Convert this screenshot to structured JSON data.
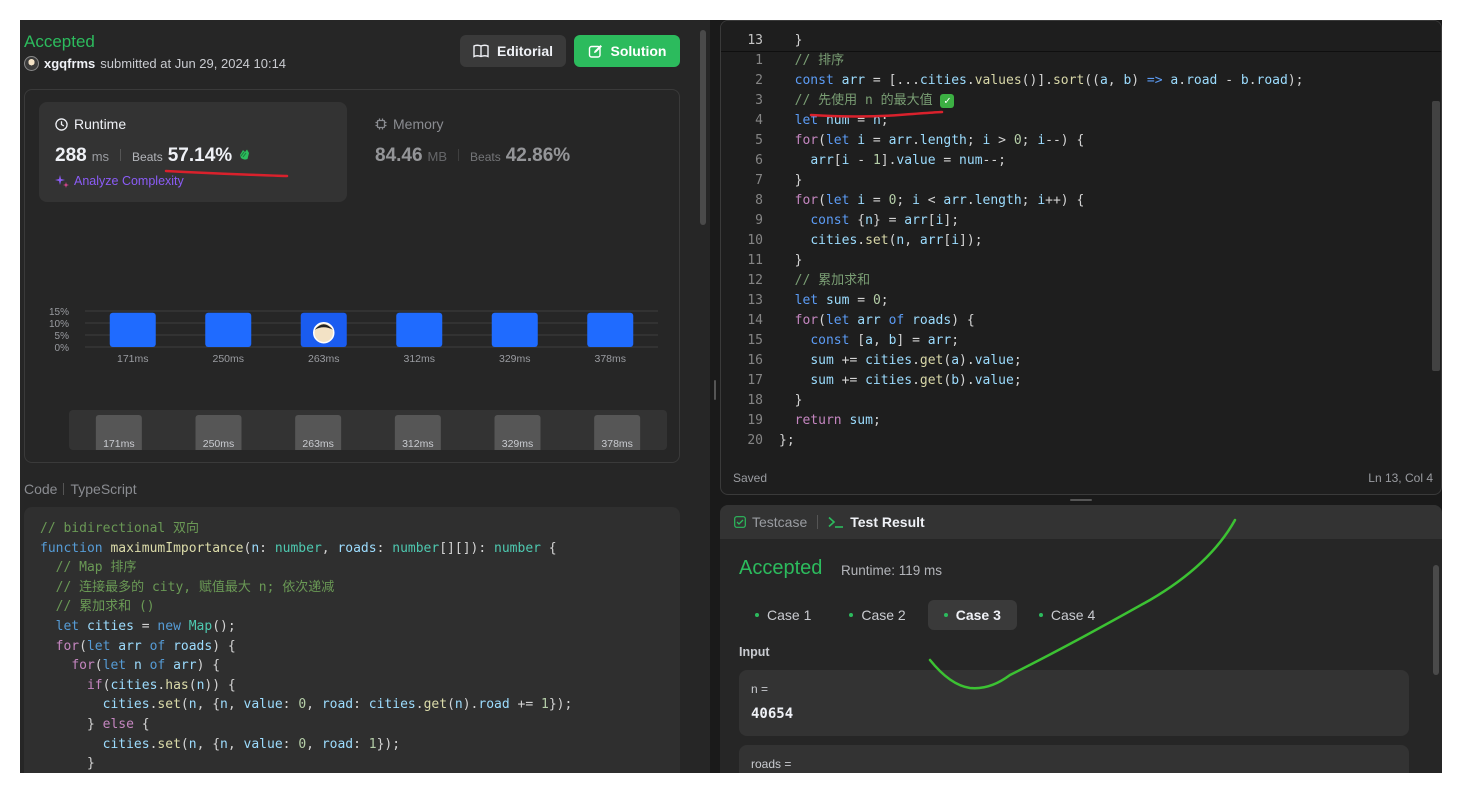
{
  "submission": {
    "status": "Accepted",
    "username": "xgqfrms",
    "submitted_text": "submitted at Jun 29, 2024 10:14"
  },
  "buttons": {
    "editorial": "Editorial",
    "solution": "Solution"
  },
  "runtime": {
    "title": "Runtime",
    "value": "288",
    "unit": "ms",
    "beats_label": "Beats",
    "beats_value": "57.14%",
    "analyze_label": "Analyze Complexity"
  },
  "memory": {
    "title": "Memory",
    "value": "84.46",
    "unit": "MB",
    "beats_label": "Beats",
    "beats_value": "42.86%"
  },
  "chart_data": {
    "type": "bar",
    "categories": [
      "171ms",
      "250ms",
      "263ms",
      "312ms",
      "329ms",
      "378ms"
    ],
    "values": [
      14.29,
      14.29,
      14.29,
      14.29,
      14.29,
      14.29
    ],
    "highlight_index": 2,
    "y_ticks": [
      "15%",
      "10%",
      "5%",
      "0%"
    ],
    "ylim": [
      0,
      15
    ],
    "grid": true,
    "title": "",
    "xlabel": "",
    "ylabel": "",
    "bar_color": "#1f6bff",
    "highlight_color": "#1a5cf0"
  },
  "mini_nav": {
    "labels": [
      "171ms",
      "250ms",
      "263ms",
      "312ms",
      "329ms",
      "378ms"
    ]
  },
  "code_section": {
    "label": "Code",
    "language": "TypeScript"
  },
  "submitted_code": [
    [
      [
        "cm",
        "// bidirectional 双向"
      ]
    ],
    [
      [
        "kw",
        "function "
      ],
      [
        "fn",
        "maximumImportance"
      ],
      [
        "pl",
        "("
      ],
      [
        "id",
        "n"
      ],
      [
        "pl",
        ": "
      ],
      [
        "ty",
        "number"
      ],
      [
        "pl",
        ", "
      ],
      [
        "id",
        "roads"
      ],
      [
        "pl",
        ": "
      ],
      [
        "ty",
        "number"
      ],
      [
        "pl",
        "[][]): "
      ],
      [
        "ty",
        "number"
      ],
      [
        "pl",
        " {"
      ]
    ],
    [
      [
        "pl",
        "  "
      ],
      [
        "cm",
        "// Map 排序"
      ]
    ],
    [
      [
        "pl",
        "  "
      ],
      [
        "cm",
        "// 连接最多的 city, 赋值最大 n; 依次递减"
      ]
    ],
    [
      [
        "pl",
        "  "
      ],
      [
        "cm",
        "// 累加求和 ()"
      ]
    ],
    [
      [
        "pl",
        "  "
      ],
      [
        "kw",
        "let "
      ],
      [
        "id",
        "cities"
      ],
      [
        "pl",
        " = "
      ],
      [
        "kw",
        "new "
      ],
      [
        "ty",
        "Map"
      ],
      [
        "pl",
        "();"
      ]
    ],
    [
      [
        "pl",
        "  "
      ],
      [
        "kw2",
        "for"
      ],
      [
        "pl",
        "("
      ],
      [
        "kw",
        "let "
      ],
      [
        "id",
        "arr "
      ],
      [
        "kw",
        "of "
      ],
      [
        "id",
        "roads"
      ],
      [
        "pl",
        ") {"
      ]
    ],
    [
      [
        "pl",
        "    "
      ],
      [
        "kw2",
        "for"
      ],
      [
        "pl",
        "("
      ],
      [
        "kw",
        "let "
      ],
      [
        "id",
        "n "
      ],
      [
        "kw",
        "of "
      ],
      [
        "id",
        "arr"
      ],
      [
        "pl",
        ") {"
      ]
    ],
    [
      [
        "pl",
        "      "
      ],
      [
        "kw2",
        "if"
      ],
      [
        "pl",
        "("
      ],
      [
        "id",
        "cities"
      ],
      [
        "pl",
        "."
      ],
      [
        "fn",
        "has"
      ],
      [
        "pl",
        "("
      ],
      [
        "id",
        "n"
      ],
      [
        "pl",
        ")) {"
      ]
    ],
    [
      [
        "pl",
        "        "
      ],
      [
        "id",
        "cities"
      ],
      [
        "pl",
        "."
      ],
      [
        "fn",
        "set"
      ],
      [
        "pl",
        "("
      ],
      [
        "id",
        "n"
      ],
      [
        "pl",
        ", {"
      ],
      [
        "id",
        "n"
      ],
      [
        "pl",
        ", "
      ],
      [
        "id",
        "value"
      ],
      [
        "pl",
        ": "
      ],
      [
        "num",
        "0"
      ],
      [
        "pl",
        ", "
      ],
      [
        "id",
        "road"
      ],
      [
        "pl",
        ": "
      ],
      [
        "id",
        "cities"
      ],
      [
        "pl",
        "."
      ],
      [
        "fn",
        "get"
      ],
      [
        "pl",
        "("
      ],
      [
        "id",
        "n"
      ],
      [
        "pl",
        ")."
      ],
      [
        "id",
        "road"
      ],
      [
        "pl",
        " += "
      ],
      [
        "num",
        "1"
      ],
      [
        "pl",
        "});"
      ]
    ],
    [
      [
        "pl",
        "      } "
      ],
      [
        "kw2",
        "else"
      ],
      [
        "pl",
        " {"
      ]
    ],
    [
      [
        "pl",
        "        "
      ],
      [
        "id",
        "cities"
      ],
      [
        "pl",
        "."
      ],
      [
        "fn",
        "set"
      ],
      [
        "pl",
        "("
      ],
      [
        "id",
        "n"
      ],
      [
        "pl",
        ", {"
      ],
      [
        "id",
        "n"
      ],
      [
        "pl",
        ", "
      ],
      [
        "id",
        "value"
      ],
      [
        "pl",
        ": "
      ],
      [
        "num",
        "0"
      ],
      [
        "pl",
        ", "
      ],
      [
        "id",
        "road"
      ],
      [
        "pl",
        ": "
      ],
      [
        "num",
        "1"
      ],
      [
        "pl",
        "});"
      ]
    ],
    [
      [
        "pl",
        "      }"
      ]
    ]
  ],
  "editor": {
    "sticky_line_number": "13",
    "sticky_line": [
      [
        "pl",
        "  }"
      ]
    ],
    "lines": [
      {
        "n": "1",
        "code": [
          [
            "pl",
            "  "
          ],
          [
            "lc-cm",
            "// 排序"
          ]
        ]
      },
      {
        "n": "2",
        "code": [
          [
            "pl",
            "  "
          ],
          [
            "lc-kw",
            "const "
          ],
          [
            "lc-id",
            "arr"
          ],
          [
            "pl",
            " = [..."
          ],
          [
            "lc-id",
            "cities"
          ],
          [
            "pl",
            "."
          ],
          [
            "lc-fn",
            "values"
          ],
          [
            "pl",
            "()]."
          ],
          [
            "lc-fn",
            "sort"
          ],
          [
            "pl",
            "(("
          ],
          [
            "lc-id",
            "a"
          ],
          [
            "pl",
            ", "
          ],
          [
            "lc-id",
            "b"
          ],
          [
            "pl",
            ") "
          ],
          [
            "lc-kw",
            "=> "
          ],
          [
            "lc-id",
            "a"
          ],
          [
            "pl",
            "."
          ],
          [
            "lc-id",
            "road"
          ],
          [
            "pl",
            " - "
          ],
          [
            "lc-id",
            "b"
          ],
          [
            "pl",
            "."
          ],
          [
            "lc-id",
            "road"
          ],
          [
            "pl",
            ");"
          ]
        ]
      },
      {
        "n": "3",
        "code": [
          [
            "pl",
            "  "
          ],
          [
            "lc-cm",
            "// 先使用 n 的最大值 "
          ],
          [
            "emoji",
            "✅"
          ]
        ]
      },
      {
        "n": "4",
        "code": [
          [
            "pl",
            "  "
          ],
          [
            "lc-kw",
            "let "
          ],
          [
            "lc-id",
            "num"
          ],
          [
            "pl",
            " = "
          ],
          [
            "lc-id",
            "n"
          ],
          [
            "pl",
            ";"
          ]
        ]
      },
      {
        "n": "5",
        "code": [
          [
            "pl",
            "  "
          ],
          [
            "kw2",
            "for"
          ],
          [
            "pl",
            "("
          ],
          [
            "lc-kw",
            "let "
          ],
          [
            "lc-id",
            "i"
          ],
          [
            "pl",
            " = "
          ],
          [
            "lc-id",
            "arr"
          ],
          [
            "pl",
            "."
          ],
          [
            "lc-id",
            "length"
          ],
          [
            "pl",
            "; "
          ],
          [
            "lc-id",
            "i"
          ],
          [
            "pl",
            " > "
          ],
          [
            "lc-num",
            "0"
          ],
          [
            "pl",
            "; "
          ],
          [
            "lc-id",
            "i"
          ],
          [
            "pl",
            "--) {"
          ]
        ]
      },
      {
        "n": "6",
        "code": [
          [
            "pl",
            "    "
          ],
          [
            "lc-id",
            "arr"
          ],
          [
            "pl",
            "["
          ],
          [
            "lc-id",
            "i"
          ],
          [
            "pl",
            " - "
          ],
          [
            "lc-num",
            "1"
          ],
          [
            "pl",
            "]."
          ],
          [
            "lc-id",
            "value"
          ],
          [
            "pl",
            " = "
          ],
          [
            "lc-id",
            "num"
          ],
          [
            "pl",
            "--;"
          ]
        ]
      },
      {
        "n": "7",
        "code": [
          [
            "pl",
            "  }"
          ]
        ]
      },
      {
        "n": "8",
        "code": [
          [
            "pl",
            "  "
          ],
          [
            "kw2",
            "for"
          ],
          [
            "pl",
            "("
          ],
          [
            "lc-kw",
            "let "
          ],
          [
            "lc-id",
            "i"
          ],
          [
            "pl",
            " = "
          ],
          [
            "lc-num",
            "0"
          ],
          [
            "pl",
            "; "
          ],
          [
            "lc-id",
            "i"
          ],
          [
            "pl",
            " < "
          ],
          [
            "lc-id",
            "arr"
          ],
          [
            "pl",
            "."
          ],
          [
            "lc-id",
            "length"
          ],
          [
            "pl",
            "; "
          ],
          [
            "lc-id",
            "i"
          ],
          [
            "pl",
            "++) {"
          ]
        ]
      },
      {
        "n": "9",
        "code": [
          [
            "pl",
            "    "
          ],
          [
            "lc-kw",
            "const "
          ],
          [
            "pl",
            "{"
          ],
          [
            "lc-id",
            "n"
          ],
          [
            "pl",
            "} = "
          ],
          [
            "lc-id",
            "arr"
          ],
          [
            "pl",
            "["
          ],
          [
            "lc-id",
            "i"
          ],
          [
            "pl",
            "];"
          ]
        ]
      },
      {
        "n": "10",
        "code": [
          [
            "pl",
            "    "
          ],
          [
            "lc-id",
            "cities"
          ],
          [
            "pl",
            "."
          ],
          [
            "lc-fn",
            "set"
          ],
          [
            "pl",
            "("
          ],
          [
            "lc-id",
            "n"
          ],
          [
            "pl",
            ", "
          ],
          [
            "lc-id",
            "arr"
          ],
          [
            "pl",
            "["
          ],
          [
            "lc-id",
            "i"
          ],
          [
            "pl",
            "]);"
          ]
        ]
      },
      {
        "n": "11",
        "code": [
          [
            "pl",
            "  }"
          ]
        ]
      },
      {
        "n": "12",
        "code": [
          [
            "pl",
            "  "
          ],
          [
            "lc-cm",
            "// 累加求和"
          ]
        ]
      },
      {
        "n": "13",
        "code": [
          [
            "pl",
            "  "
          ],
          [
            "lc-kw",
            "let "
          ],
          [
            "lc-id",
            "sum"
          ],
          [
            "pl",
            " = "
          ],
          [
            "lc-num",
            "0"
          ],
          [
            "pl",
            ";"
          ]
        ]
      },
      {
        "n": "14",
        "code": [
          [
            "pl",
            "  "
          ],
          [
            "kw2",
            "for"
          ],
          [
            "pl",
            "("
          ],
          [
            "lc-kw",
            "let "
          ],
          [
            "lc-id",
            "arr "
          ],
          [
            "lc-kw",
            "of "
          ],
          [
            "lc-id",
            "roads"
          ],
          [
            "pl",
            ") {"
          ]
        ]
      },
      {
        "n": "15",
        "code": [
          [
            "pl",
            "    "
          ],
          [
            "lc-kw",
            "const "
          ],
          [
            "pl",
            "["
          ],
          [
            "lc-id",
            "a"
          ],
          [
            "pl",
            ", "
          ],
          [
            "lc-id",
            "b"
          ],
          [
            "pl",
            "] = "
          ],
          [
            "lc-id",
            "arr"
          ],
          [
            "pl",
            ";"
          ]
        ]
      },
      {
        "n": "16",
        "code": [
          [
            "pl",
            "    "
          ],
          [
            "lc-id",
            "sum"
          ],
          [
            "pl",
            " += "
          ],
          [
            "lc-id",
            "cities"
          ],
          [
            "pl",
            "."
          ],
          [
            "lc-fn",
            "get"
          ],
          [
            "pl",
            "("
          ],
          [
            "lc-id",
            "a"
          ],
          [
            "pl",
            ")."
          ],
          [
            "lc-id",
            "value"
          ],
          [
            "pl",
            ";"
          ]
        ]
      },
      {
        "n": "17",
        "code": [
          [
            "pl",
            "    "
          ],
          [
            "lc-id",
            "sum"
          ],
          [
            "pl",
            " += "
          ],
          [
            "lc-id",
            "cities"
          ],
          [
            "pl",
            "."
          ],
          [
            "lc-fn",
            "get"
          ],
          [
            "pl",
            "("
          ],
          [
            "lc-id",
            "b"
          ],
          [
            "pl",
            ")."
          ],
          [
            "lc-id",
            "value"
          ],
          [
            "pl",
            ";"
          ]
        ]
      },
      {
        "n": "18",
        "code": [
          [
            "pl",
            "  }"
          ]
        ]
      },
      {
        "n": "19",
        "code": [
          [
            "pl",
            "  "
          ],
          [
            "kw2",
            "return "
          ],
          [
            "lc-id",
            "sum"
          ],
          [
            "pl",
            ";"
          ]
        ]
      },
      {
        "n": "20",
        "code": [
          [
            "pl",
            "};"
          ]
        ]
      }
    ],
    "footer_saved": "Saved",
    "footer_position": "Ln 13, Col 4"
  },
  "results": {
    "tab_testcase": "Testcase",
    "tab_result": "Test Result",
    "status": "Accepted",
    "runtime": "Runtime: 119 ms",
    "cases": [
      "Case 1",
      "Case 2",
      "Case 3",
      "Case 4"
    ],
    "active_case": 2,
    "input_label": "Input",
    "param1_name": "n =",
    "param1_value": "40654",
    "param2_name": "roads ="
  },
  "colors": {
    "accent_green": "#2cbb5d",
    "bar_blue": "#1f6bff",
    "annotation_red": "#d9212c",
    "annotation_green": "#3cc233"
  }
}
